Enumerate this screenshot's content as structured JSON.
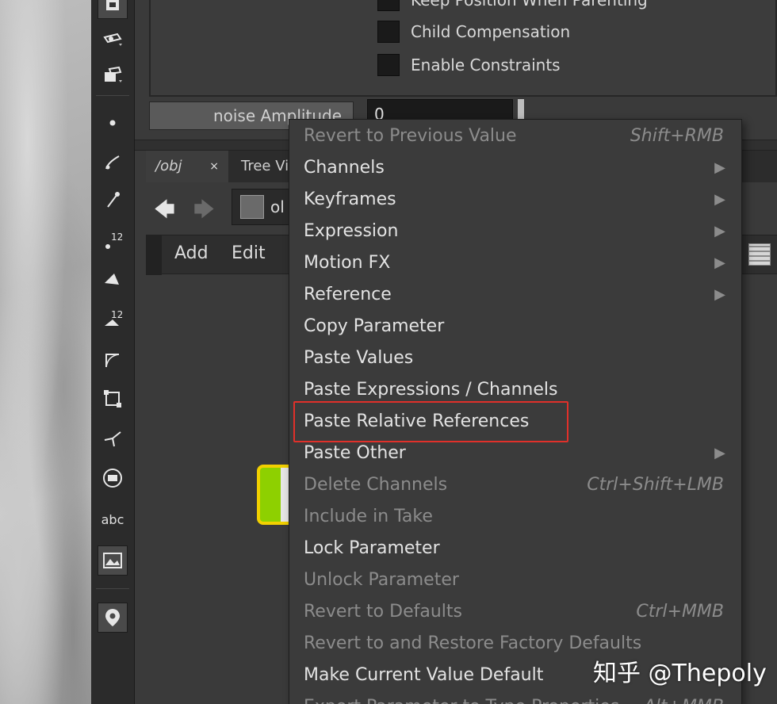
{
  "params": {
    "checkbox_1": "Keep Position When Parenting",
    "checkbox_2": "Child Compensation",
    "checkbox_3": "Enable Constraints",
    "noise_label": "noise Amplitude",
    "noise_value": "0"
  },
  "tabs": [
    {
      "label": "/obj",
      "close": "×"
    },
    {
      "label": "Tree Vi"
    }
  ],
  "navbar": {
    "path": "ol"
  },
  "menubar": {
    "add": "Add",
    "edit": "Edit"
  },
  "menu": {
    "items": [
      {
        "label": "Revert to Previous Value",
        "shortcut": "Shift+RMB",
        "disabled": true
      },
      {
        "label": "Channels",
        "arrow": "▶"
      },
      {
        "label": "Keyframes",
        "arrow": "▶"
      },
      {
        "label": "Expression",
        "arrow": "▶"
      },
      {
        "label": "Motion FX",
        "arrow": "▶"
      },
      {
        "label": "Reference",
        "arrow": "▶"
      },
      {
        "label": "Copy Parameter"
      },
      {
        "label": "Paste Values"
      },
      {
        "label": "Paste Expressions / Channels"
      },
      {
        "label": "Paste Relative References"
      },
      {
        "label": "Paste Other",
        "arrow": "▶"
      },
      {
        "label": "Delete Channels",
        "shortcut": "Ctrl+Shift+LMB",
        "disabled": true
      },
      {
        "label": "Include in Take",
        "disabled": true
      },
      {
        "label": "Lock Parameter"
      },
      {
        "label": "Unlock Parameter",
        "disabled": true
      },
      {
        "label": "Revert to Defaults",
        "shortcut": "Ctrl+MMB",
        "disabled": true
      },
      {
        "label": "Revert to and Restore Factory Defaults",
        "disabled": true
      },
      {
        "label": "Make Current Value Default"
      },
      {
        "label": "Export Parameter to Type Properties",
        "shortcut": "Alt+MMB",
        "disabled": true
      }
    ]
  },
  "toolbar": {
    "label_12a": "12",
    "label_12b": "12",
    "abc": "abc"
  },
  "watermark": "知乎 @Thepoly",
  "colors": {
    "highlight": "#e0302a",
    "node_fill": "#8ed000",
    "node_border": "#f2d000"
  }
}
